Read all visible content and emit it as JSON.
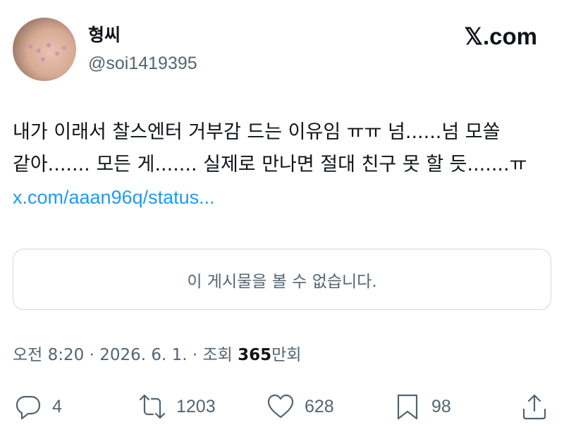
{
  "author": {
    "display_name": "형씨",
    "handle": "@soi1419395"
  },
  "brand": {
    "logo_text": "𝕏.com"
  },
  "tweet": {
    "text": "내가 이래서 찰스엔터 거부감 드는 이유임 ㅠㅠ 넘......넘 모쏠 같아....... 모든 게....... 실제로 만나면 절대 친구 못 할 듯.......ㅠ ",
    "link_text": "x.com/aaan96q/status..."
  },
  "quoted_post": {
    "unavailable_text": "이 게시물을 볼 수 없습니다."
  },
  "meta": {
    "time": "오전 8:20",
    "separator": " · ",
    "date": "2026. 6. 1.",
    "views_label": "조회 ",
    "views_count": "365",
    "views_unit": "만회"
  },
  "actions": {
    "replies": "4",
    "reposts": "1203",
    "likes": "628",
    "bookmarks": "98"
  },
  "icons": {
    "reply": "reply-icon",
    "repost": "repost-icon",
    "like": "heart-icon",
    "bookmark": "bookmark-icon",
    "share": "share-icon"
  },
  "colors": {
    "link": "#1d9bf0",
    "secondary_text": "#536471",
    "primary_text": "#0f1419"
  }
}
